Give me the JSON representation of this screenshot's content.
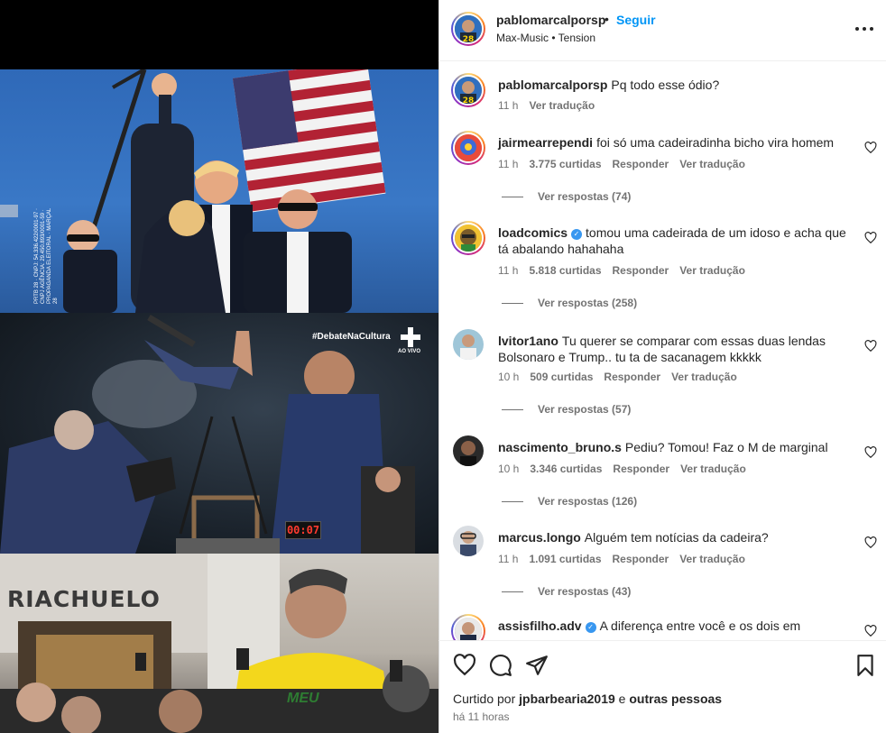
{
  "media": {
    "panel2_hashtag": "#DebateNaCultura",
    "panel2_live": "AO VIVO",
    "panel2_timer": "00:07",
    "panel2_vertical_text": "PRTB 28 · CNPJ: 54.336.422/0001-97 · CNPJ AGÊNCIA: 29.450.893/0001-59 · PROPAGANDA ELEITORAL · MARÇAL 28",
    "panel3_sign": "RIACHUELO",
    "panel3_shirt": "MEU"
  },
  "header": {
    "username": "pablomarcalporsp",
    "dot": "•",
    "follow_label": "Seguir",
    "music": "Max-Music • Tension"
  },
  "caption": {
    "username": "pablomarcalporsp",
    "text": "Pq todo esse ódio?",
    "time": "11 h",
    "translate": "Ver tradução"
  },
  "comments": [
    {
      "username": "jairmearrependi",
      "verified": false,
      "text": "foi só uma cadeiradinha bicho vira homem",
      "time": "11 h",
      "likes": "3.775 curtidas",
      "reply": "Responder",
      "translate": "Ver tradução",
      "replies": "Ver respostas (74)"
    },
    {
      "username": "loadcomics",
      "verified": true,
      "text": "tomou uma cadeirada de um idoso e acha que tá abalando hahahaha",
      "time": "11 h",
      "likes": "5.818 curtidas",
      "reply": "Responder",
      "translate": "Ver tradução",
      "replies": "Ver respostas (258)"
    },
    {
      "username": "lvitor1ano",
      "verified": false,
      "text": "Tu querer se comparar com essas duas lendas Bolsonaro e Trump.. tu ta de sacanagem kkkkk",
      "time": "10 h",
      "likes": "509 curtidas",
      "reply": "Responder",
      "translate": "Ver tradução",
      "replies": "Ver respostas (57)"
    },
    {
      "username": "nascimento_bruno.s",
      "verified": false,
      "text": "Pediu? Tomou! Faz o M de marginal",
      "time": "10 h",
      "likes": "3.346 curtidas",
      "reply": "Responder",
      "translate": "Ver tradução",
      "replies": "Ver respostas (126)"
    },
    {
      "username": "marcus.longo",
      "verified": false,
      "text": "Alguém tem notícias da cadeira?",
      "time": "11 h",
      "likes": "1.091 curtidas",
      "reply": "Responder",
      "translate": "Ver tradução",
      "replies": "Ver respostas (43)"
    },
    {
      "username": "assisfilho.adv",
      "verified": true,
      "text": "A diferença entre você e os dois em"
    }
  ],
  "footer": {
    "liked_by_prefix": "Curtido por",
    "liked_by_user": "jpbarbearia2019",
    "liked_by_mid": "e",
    "liked_by_others": "outras pessoas",
    "time_ago": "há 11 horas"
  },
  "icons": {
    "like": "heart-icon",
    "comment": "comment-icon",
    "share": "share-icon",
    "save": "bookmark-icon",
    "more": "more-options-icon",
    "verified": "verified-badge-icon"
  },
  "colors": {
    "link_blue": "#0095f6",
    "verified_blue": "#3897f0",
    "text_primary": "#262626",
    "text_secondary": "#737373",
    "timer_red": "#ff3a2f"
  }
}
